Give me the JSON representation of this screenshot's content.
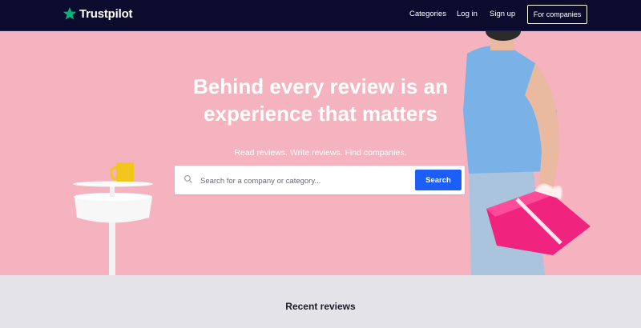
{
  "brand": {
    "name": "Trustpilot",
    "star_color": "#00b67a"
  },
  "nav": {
    "categories": "Categories",
    "login": "Log in",
    "signup": "Sign up",
    "for_companies": "For companies"
  },
  "hero": {
    "headline_line1": "Behind every review is an",
    "headline_line2": "experience that matters",
    "subtitle": "Read reviews. Write reviews. Find companies.",
    "search_placeholder": "Search for a company or category...",
    "search_button": "Search",
    "icons": [
      "search-icon",
      "star-logo-icon"
    ]
  },
  "recent": {
    "title": "Recent reviews"
  },
  "colors": {
    "nav_bg": "#0b0b2e",
    "hero_bg": "#f5b3bf",
    "button_blue": "#1b5ff7"
  }
}
